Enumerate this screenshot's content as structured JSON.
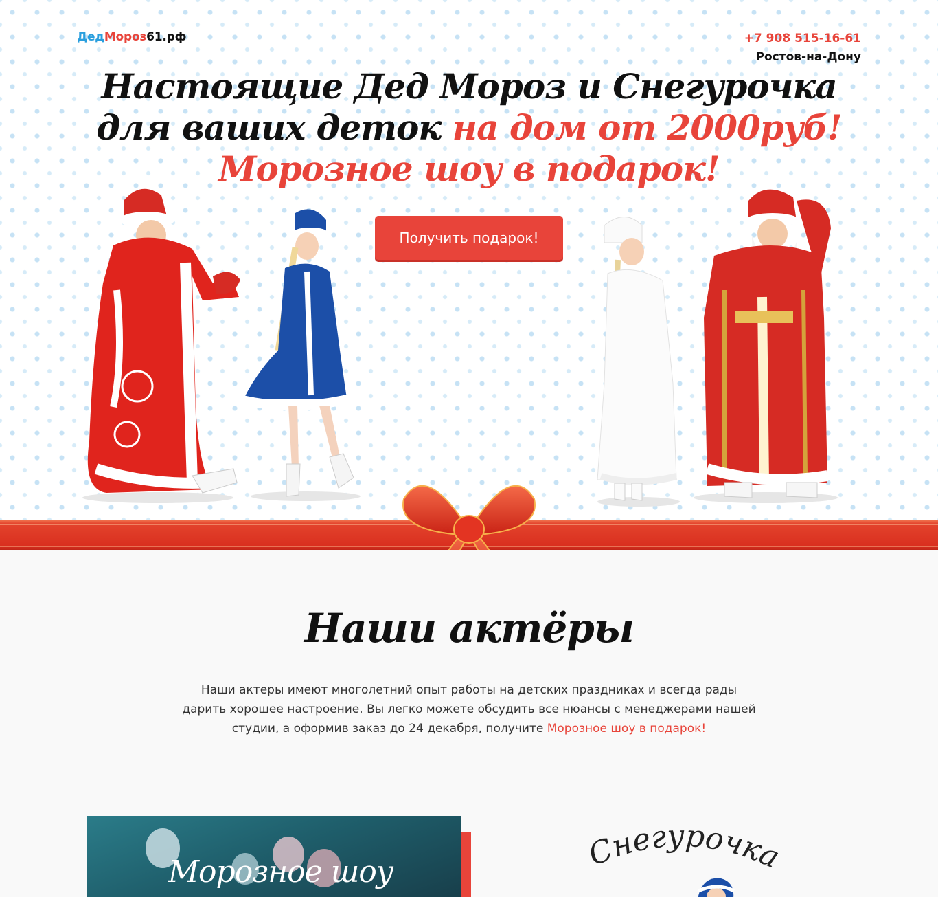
{
  "header": {
    "logo_part1": "Дед",
    "logo_part2": "Мороз",
    "logo_part3": "61.рф",
    "phone": "+7 908 515-16-61",
    "city": "Ростов-на-Дону"
  },
  "hero": {
    "line1": "Настоящие Дед Мороз и Снегурочка",
    "line2_black": "для ваших деток",
    "line2_red": "на дом от 2000руб!",
    "line3": "Морозное шоу в подарок!",
    "cta_label": "Получить подарок!"
  },
  "actors": {
    "title": "Наши актёры",
    "text": "Наши актеры имеют многолетний опыт работы на детских праздниках и всегда рады дарить хорошее настроение. Вы легко можете обсудить все нюансы с менеджерами нашей студии, а оформив заказ до 24 декабря, получите",
    "link": "Морозное шоу в подарок!"
  },
  "gallery": {
    "photo_caption": "Морозное шоу",
    "character_title": "Снегурочка"
  },
  "colors": {
    "accent": "#e8443a",
    "logo_blue": "#2a9fde",
    "snowflake": "#c6e2f5",
    "blue_coat": "#1c4fa8"
  }
}
